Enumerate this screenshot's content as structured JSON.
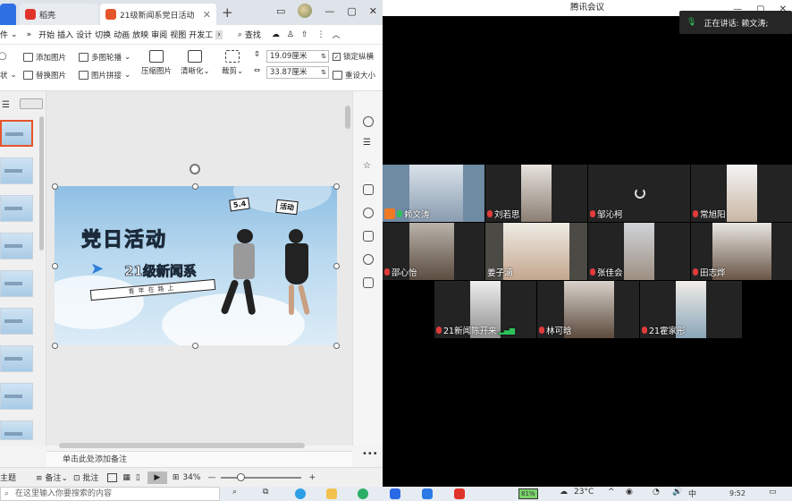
{
  "wps": {
    "tabs": [
      {
        "label": ""
      },
      {
        "label": "稻壳"
      },
      {
        "label": "21级新闻系党日活动"
      }
    ],
    "menu": [
      "件",
      "»",
      "开始",
      "插入",
      "设计",
      "切换",
      "动画",
      "放映",
      "审阅",
      "视图",
      "开发工"
    ],
    "menu_more": "›",
    "search_label": "查找",
    "toolbar": {
      "add_image": "添加图片",
      "multi_carousel": "多图轮播",
      "replace_image": "替换图片",
      "image_collage": "图片拼接",
      "compress_image": "压缩图片",
      "clarity": "清晰化",
      "crop": "裁剪",
      "shape_label": "状",
      "height_value": "19.09厘米",
      "width_value": "33.87厘米",
      "lock_ratio": "锁定纵横",
      "reset_size": "重设大小"
    },
    "slide": {
      "title": "党日活动",
      "subtitle": "21级新闻系",
      "banner": "青年在路上",
      "tag1": "5.4",
      "tag2": "活动"
    },
    "notes_placeholder": "单击此处添加备注",
    "status": {
      "theme": "主题",
      "notes": "备注",
      "comments": "批注",
      "zoom": "34%"
    }
  },
  "meeting": {
    "window_title": "腾讯会议",
    "speaking_label": "正在讲话: 赖文涛;",
    "participants": [
      {
        "name": "赖文涛",
        "mic": "on",
        "host": true
      },
      {
        "name": "刘若思",
        "mic": "off"
      },
      {
        "name": "邹沁柯",
        "mic": "off",
        "loading": true
      },
      {
        "name": "常旭阳",
        "mic": "off"
      },
      {
        "name": "邵心怡",
        "mic": "off"
      },
      {
        "name": "姜子涵",
        "mic": "none"
      },
      {
        "name": "张佳会",
        "mic": "off"
      },
      {
        "name": "田志烨",
        "mic": "off"
      },
      {
        "name": "21新闻陈开来",
        "mic": "off",
        "signal": true
      },
      {
        "name": "林可晗",
        "mic": "off"
      },
      {
        "name": "21霍家彤",
        "mic": "off"
      }
    ]
  },
  "taskbar": {
    "search_placeholder": "在这里输入你要搜索的内容",
    "battery": "81%",
    "weather": "23°C",
    "time": "9:52"
  },
  "colors": {
    "wps_accent": "#e5552a",
    "mic_off": "#e03b3b",
    "mic_on": "#2fc25b"
  }
}
